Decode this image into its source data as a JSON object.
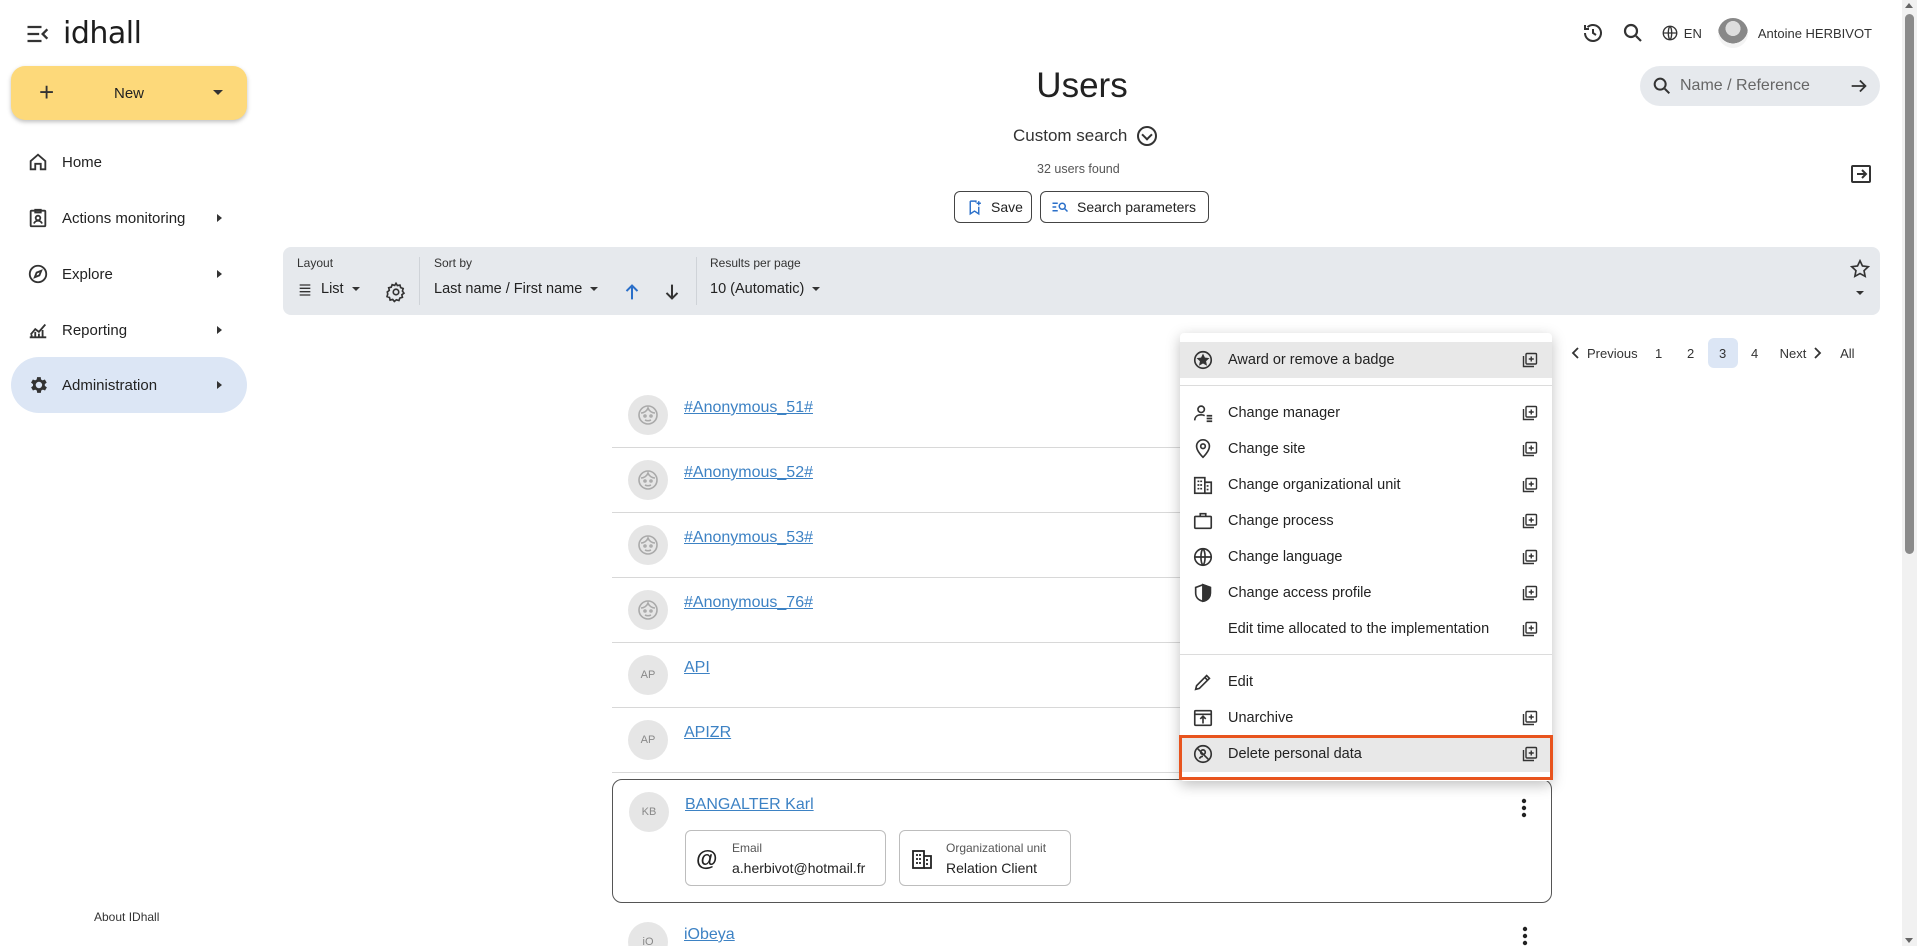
{
  "app": {
    "logo": "idhall"
  },
  "sidebar": {
    "new_label": "New",
    "items": [
      {
        "label": "Home",
        "icon": "home-icon"
      },
      {
        "label": "Actions monitoring",
        "icon": "clipboard-user-icon"
      },
      {
        "label": "Explore",
        "icon": "compass-icon"
      },
      {
        "label": "Reporting",
        "icon": "chart-line-icon"
      },
      {
        "label": "Administration",
        "icon": "gear-icon",
        "active": true
      }
    ],
    "about": "About IDhall"
  },
  "topbar": {
    "language": "EN",
    "user_name": "Antoine HERBIVOT",
    "search_placeholder": "Name / Reference"
  },
  "main": {
    "title": "Users",
    "custom_search": "Custom search",
    "results_count": "32 users found",
    "save_label": "Save",
    "search_params_label": "Search parameters"
  },
  "toolbar": {
    "layout_label": "Layout",
    "layout_value": "List",
    "sort_label": "Sort by",
    "sort_value": "Last name / First name",
    "results_label": "Results per page",
    "results_value": "10 (Automatic)"
  },
  "pagination": {
    "previous": "Previous",
    "pages": [
      "1",
      "2",
      "3",
      "4"
    ],
    "current": "3",
    "next": "Next",
    "all": "All"
  },
  "users": [
    {
      "initials": "",
      "name": "#Anonymous_51#",
      "anonymous": true
    },
    {
      "initials": "",
      "name": "#Anonymous_52#",
      "anonymous": true
    },
    {
      "initials": "",
      "name": "#Anonymous_53#",
      "anonymous": true
    },
    {
      "initials": "",
      "name": "#Anonymous_76#",
      "anonymous": true
    },
    {
      "initials": "AP",
      "name": "API"
    },
    {
      "initials": "AP",
      "name": "APIZR"
    }
  ],
  "selected_user": {
    "initials": "KB",
    "name": "BANGALTER Karl",
    "email_label": "Email",
    "email_value": "a.herbivot@hotmail.fr",
    "org_label": "Organizational unit",
    "org_value": "Relation Client"
  },
  "next_user": {
    "initials": "iO",
    "name": "iObeya"
  },
  "context_menu": {
    "items": [
      {
        "label": "Award or remove a badge",
        "icon": "badge-star-icon"
      },
      {
        "label": "Change manager",
        "icon": "manager-icon"
      },
      {
        "label": "Change site",
        "icon": "location-pin-icon"
      },
      {
        "label": "Change organizational unit",
        "icon": "building-icon"
      },
      {
        "label": "Change process",
        "icon": "briefcase-icon"
      },
      {
        "label": "Change language",
        "icon": "globe-icon"
      },
      {
        "label": "Change access profile",
        "icon": "shield-icon"
      },
      {
        "label": "Edit time allocated to the implementation",
        "icon": ""
      },
      {
        "label": "Edit",
        "icon": "pencil-icon"
      },
      {
        "label": "Unarchive",
        "icon": "unarchive-icon"
      },
      {
        "label": "Delete personal data",
        "icon": "no-face-icon"
      }
    ],
    "highlight_color": "#e8541e"
  }
}
